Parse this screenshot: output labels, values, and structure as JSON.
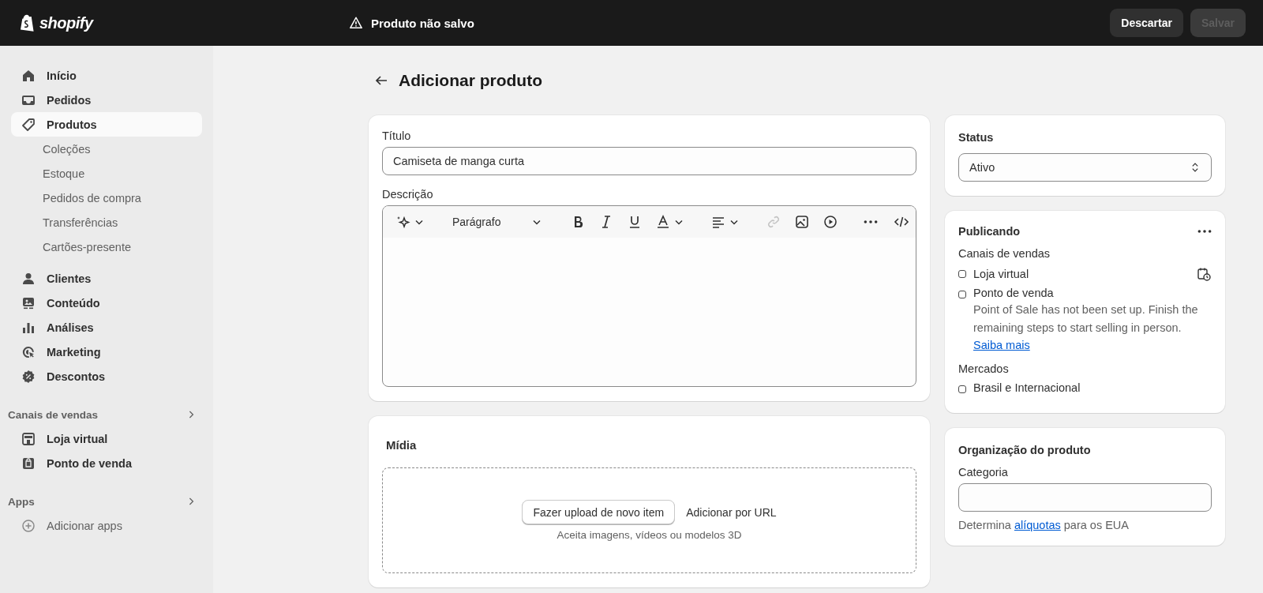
{
  "topbar": {
    "logo": "shopify",
    "notice": "Produto não salvo",
    "buttons": [
      {
        "label": "Descartar",
        "disabled": false
      },
      {
        "label": "Salvar",
        "disabled": true
      }
    ]
  },
  "sidebar": {
    "items": [
      {
        "kind": "main",
        "label": "Início",
        "selected": false
      },
      {
        "kind": "main",
        "label": "Pedidos",
        "selected": false
      },
      {
        "kind": "main",
        "label": "Produtos",
        "selected": true
      },
      {
        "kind": "sub",
        "label": "Coleções",
        "selected": false
      },
      {
        "kind": "sub",
        "label": "Estoque",
        "selected": false
      },
      {
        "kind": "sub",
        "label": "Pedidos de compra",
        "selected": false
      },
      {
        "kind": "sub",
        "label": "Transferências",
        "selected": false
      },
      {
        "kind": "sub",
        "label": "Cartões-presente",
        "selected": false
      },
      {
        "kind": "main",
        "label": "Clientes",
        "selected": false
      },
      {
        "kind": "main",
        "label": "Conteúdo",
        "selected": false
      },
      {
        "kind": "main",
        "label": "Análises",
        "selected": false
      },
      {
        "kind": "main",
        "label": "Marketing",
        "selected": false
      },
      {
        "kind": "main",
        "label": "Descontos",
        "selected": false
      },
      {
        "kind": "section",
        "label": "Canais de vendas"
      },
      {
        "kind": "main",
        "label": "Loja virtual",
        "selected": false
      },
      {
        "kind": "main",
        "label": "Ponto de venda",
        "selected": false
      },
      {
        "kind": "section",
        "label": "Apps"
      },
      {
        "kind": "add",
        "label": "Adicionar apps",
        "selected": false
      }
    ]
  },
  "page": {
    "title": "Adicionar produto"
  },
  "product": {
    "title_label": "Título",
    "title_value": "Camiseta de manga curta",
    "description_label": "Descrição",
    "editor": {
      "format": "Parágrafo",
      "tools": [
        {
          "disabled": false
        },
        {
          "disabled": false
        },
        {
          "disabled": false
        },
        {
          "disabled": false
        },
        {
          "disabled": false
        },
        {
          "disabled": false
        },
        {
          "disabled": true
        },
        {
          "disabled": false
        },
        {
          "disabled": false
        },
        {
          "disabled": false
        },
        {
          "disabled": false
        }
      ]
    }
  },
  "media": {
    "title": "Mídia",
    "upload_button": "Fazer upload de novo item",
    "url_link": "Adicionar por URL",
    "hint": "Aceita imagens, vídeos ou modelos 3D"
  },
  "status": {
    "title": "Status",
    "value": "Ativo"
  },
  "publishing": {
    "title": "Publicando",
    "channels_label": "Canais de vendas",
    "channels": [
      {
        "name": "Loja virtual",
        "checked": false
      },
      {
        "name": "Ponto de venda",
        "checked": false,
        "note": "Point of Sale has not been set up. Finish the remaining steps to start selling in person.",
        "link": "Saiba mais"
      }
    ],
    "markets_label": "Mercados",
    "markets": [
      {
        "name": "Brasil e Internacional",
        "checked": false
      }
    ]
  },
  "organization": {
    "title": "Organização do produto",
    "category_label": "Categoria",
    "help_before": "Determina ",
    "help_link": "alíquotas",
    "help_after": " para os EUA"
  }
}
